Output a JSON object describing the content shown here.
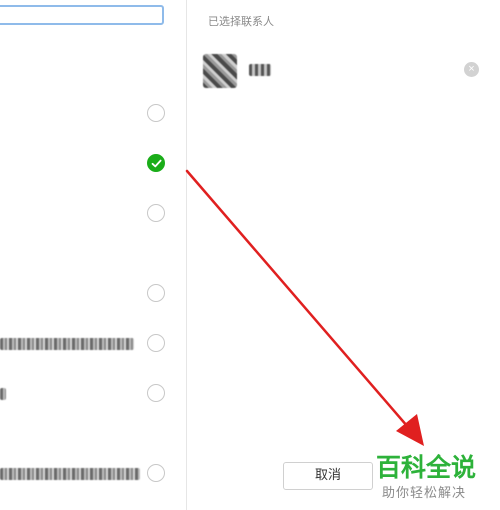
{
  "right_panel": {
    "title": "已选择联系人",
    "remove_symbol": "×"
  },
  "contacts": [
    {
      "checked": false
    },
    {
      "checked": true
    },
    {
      "checked": false
    },
    {
      "checked": false
    },
    {
      "checked": false
    },
    {
      "checked": false
    },
    {
      "checked": false
    }
  ],
  "footer": {
    "cancel_label": "取消"
  },
  "watermark": {
    "title": "百科全说",
    "subtitle": "助你轻松解决"
  },
  "colors": {
    "accent_green": "#1aad19",
    "arrow_red": "#e02020",
    "watermark_green": "#2db23a"
  }
}
